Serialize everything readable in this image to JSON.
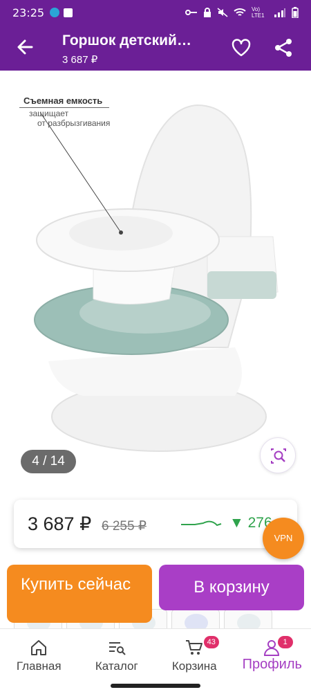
{
  "status_bar": {
    "time": "23:25",
    "network": "Vo) LTE1"
  },
  "app_bar": {
    "title": "Горшок детский…",
    "price": "3 687 ₽"
  },
  "gallery": {
    "callout_title": "Съемная емкость",
    "callout_lines": [
      "защищает",
      "от разбрызгивания"
    ],
    "counter": "4 / 14"
  },
  "price_card": {
    "current": "3 687 ₽",
    "old": "6 255 ₽",
    "delta": "▼ 276"
  },
  "vpn_label": "VPN",
  "actions": {
    "buy_now": "Купить сейчас",
    "to_cart": "В корзину"
  },
  "nav": {
    "items": [
      {
        "label": "Главная",
        "icon": "home-icon"
      },
      {
        "label": "Каталог",
        "icon": "catalog-search-icon"
      },
      {
        "label": "Корзина",
        "icon": "cart-icon",
        "badge": "43"
      },
      {
        "label": "Профиль",
        "icon": "profile-icon",
        "badge": "1",
        "active": true
      }
    ]
  },
  "colors": {
    "brand": "#6b1f96",
    "accent": "#a93ec6",
    "orange": "#f58b1f",
    "badge": "#e02f6a",
    "green": "#2fa34c"
  }
}
